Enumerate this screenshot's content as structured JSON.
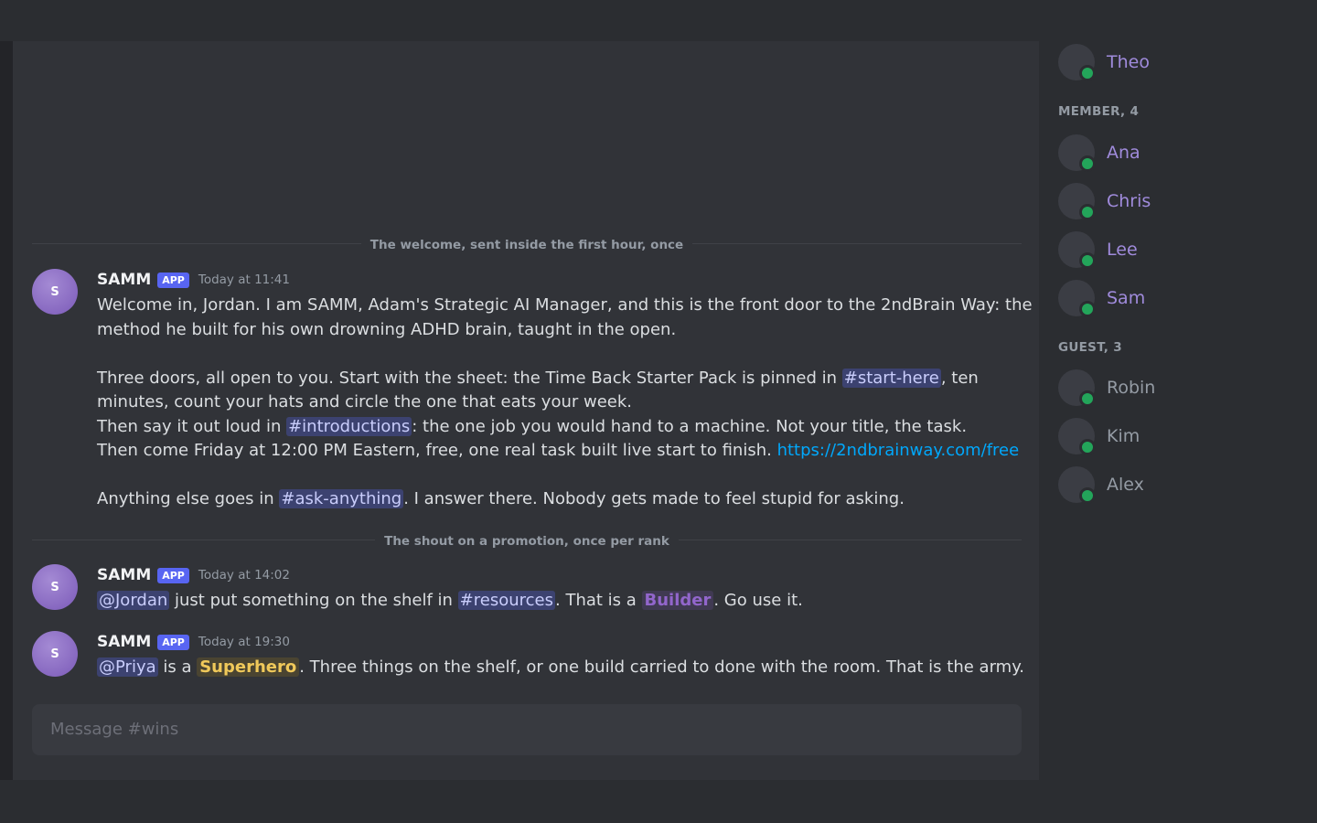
{
  "channel": {
    "input_placeholder": "Message #wins"
  },
  "dividers": {
    "welcome": "The welcome, sent inside the first hour, once",
    "promotion": "The shout on a promotion, once per rank"
  },
  "messages": [
    {
      "avatar_initial": "S",
      "author": "SAMM",
      "badge": "APP",
      "timestamp": "Today at 11:41",
      "l1": "Welcome in, Jordan. I am SAMM, Adam's Strategic AI Manager, and this is the front door to the 2ndBrain Way: the",
      "l2": "method he built for his own drowning ADHD brain, taught in the open.",
      "l3a": "Three doors, all open to you. Start with the sheet: the Time Back Starter Pack is pinned in ",
      "l3chan": "#start-here",
      "l3b": ", ten",
      "l4": "minutes, count your hats and circle the one that eats your week.",
      "l5a": "Then say it out loud in ",
      "l5chan": "#introductions",
      "l5b": ": the one job you would hand to a machine. Not your title, the task.",
      "l6a": "Then come Friday at 12:00 PM Eastern, free, one real task built live start to finish. ",
      "l6link": "https://2ndbrainway.com/free",
      "l7a": "Anything else goes in ",
      "l7chan": "#ask-anything",
      "l7b": ". I answer there. Nobody gets made to feel stupid for asking."
    },
    {
      "avatar_initial": "S",
      "author": "SAMM",
      "badge": "APP",
      "timestamp": "Today at 14:02",
      "mention": "@Jordan",
      "t1": " just put something on the shelf in ",
      "chan": "#resources",
      "t2": ". That is a ",
      "role": "Builder",
      "t3": ". Go use it."
    },
    {
      "avatar_initial": "S",
      "author": "SAMM",
      "badge": "APP",
      "timestamp": "Today at 19:30",
      "mention": "@Priya",
      "t1": " is a ",
      "role": "Superhero",
      "t2": ". Three things on the shelf, or one build carried to done with the room. That is the army."
    }
  ],
  "members": {
    "top": [
      {
        "name": "Theo"
      }
    ],
    "member_label": "MEMBER, 4",
    "member_list": [
      {
        "name": "Ana"
      },
      {
        "name": "Chris"
      },
      {
        "name": "Lee"
      },
      {
        "name": "Sam"
      }
    ],
    "guest_label": "GUEST, 3",
    "guest_list": [
      {
        "name": "Robin"
      },
      {
        "name": "Kim"
      },
      {
        "name": "Alex"
      }
    ]
  },
  "colors": {
    "accent": "#5865f2",
    "online": "#23a55a",
    "link": "#00a8fc",
    "builder_role": "#9266cc",
    "superhero_role": "#f0c95a"
  }
}
